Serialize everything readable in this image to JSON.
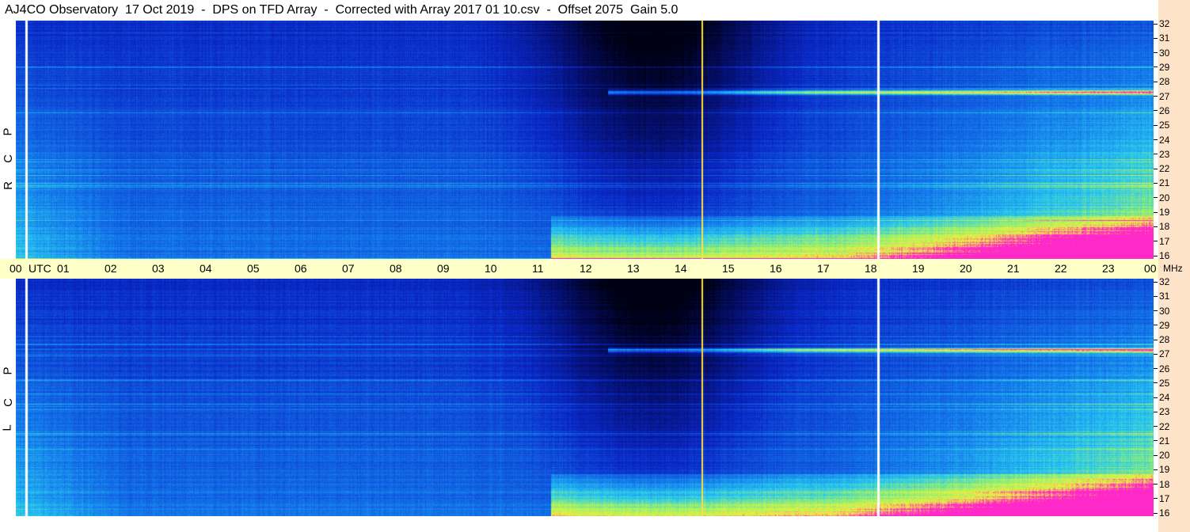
{
  "window": {
    "title": "AJ4CO Observatory  17 Oct 2019  -  DPS on TFD Array  -  Corrected with Array 2017 01 10.csv  -  Offset 2075  Gain 5.0"
  },
  "panels": [
    {
      "id": "rcp",
      "polarization_letters": [
        "P",
        "C",
        "R"
      ]
    },
    {
      "id": "lcp",
      "polarization_letters": [
        "P",
        "C",
        "L"
      ]
    }
  ],
  "time_axis": {
    "unit_label": "UTC",
    "ticks": [
      "00",
      "01",
      "02",
      "03",
      "04",
      "05",
      "06",
      "07",
      "08",
      "09",
      "10",
      "11",
      "12",
      "13",
      "14",
      "15",
      "16",
      "17",
      "18",
      "19",
      "20",
      "21",
      "22",
      "23",
      "00"
    ]
  },
  "freq_axis": {
    "unit_label": "MHz",
    "ticks": [
      "32",
      "31",
      "30",
      "29",
      "28",
      "27",
      "26",
      "25",
      "24",
      "23",
      "22",
      "21",
      "20",
      "19",
      "18",
      "17",
      "16"
    ]
  },
  "colors": {
    "background": "#ffffff",
    "time_bar": "#ffffc8",
    "right_strip": "#fde3c8",
    "deep_blue": "#0a1eb4",
    "dark": "#000018",
    "cyan": "#28c8f0",
    "yellow_green": "#c8f050",
    "magenta": "#ff30c8"
  }
}
